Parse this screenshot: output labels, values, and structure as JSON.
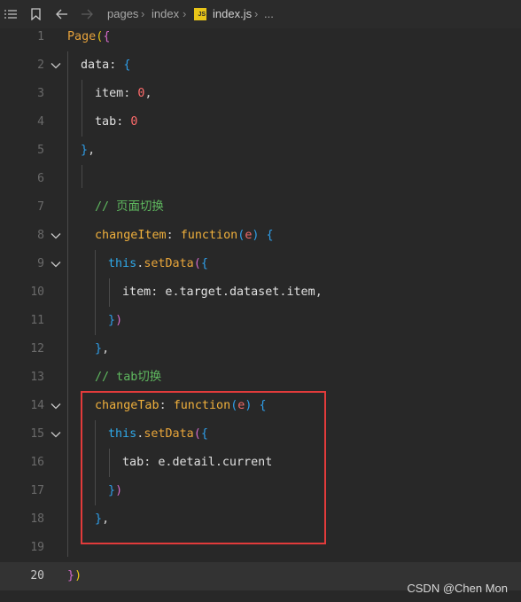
{
  "breadcrumb": {
    "items": [
      "pages",
      "index",
      "index.js",
      "..."
    ],
    "file_badge": "JS"
  },
  "editor": {
    "current_line": 20,
    "lines": [
      {
        "n": "1",
        "tokens": [
          [
            "Page",
            "t-page"
          ],
          [
            "(",
            "t-brace1"
          ],
          [
            "{",
            "t-brace2"
          ]
        ]
      },
      {
        "n": "2",
        "tokens": [
          [
            "data",
            "t-key"
          ],
          [
            ": ",
            "t-punc"
          ],
          [
            "{",
            "t-brace3"
          ]
        ]
      },
      {
        "n": "3",
        "tokens": [
          [
            "item",
            "t-key"
          ],
          [
            ": ",
            "t-punc"
          ],
          [
            "0",
            "t-num"
          ],
          [
            ",",
            "t-punc"
          ]
        ]
      },
      {
        "n": "4",
        "tokens": [
          [
            "tab",
            "t-key"
          ],
          [
            ": ",
            "t-punc"
          ],
          [
            "0",
            "t-num"
          ]
        ]
      },
      {
        "n": "5",
        "tokens": [
          [
            "}",
            "t-brace3"
          ],
          [
            ",",
            "t-punc"
          ]
        ]
      },
      {
        "n": "6",
        "tokens": []
      },
      {
        "n": "7",
        "tokens": [
          [
            "// 页面切换",
            "t-comment"
          ]
        ]
      },
      {
        "n": "8",
        "tokens": [
          [
            "changeItem",
            "t-func"
          ],
          [
            ": ",
            "t-punc"
          ],
          [
            "function",
            "t-keyword"
          ],
          [
            "(",
            "t-brace3"
          ],
          [
            "e",
            "t-param"
          ],
          [
            ") ",
            "t-brace3"
          ],
          [
            "{",
            "t-brace3"
          ]
        ]
      },
      {
        "n": "9",
        "tokens": [
          [
            "this",
            "t-this"
          ],
          [
            ".",
            "t-punc"
          ],
          [
            "setData",
            "t-method"
          ],
          [
            "(",
            "t-brace2"
          ],
          [
            "{",
            "t-brace3"
          ]
        ]
      },
      {
        "n": "10",
        "tokens": [
          [
            "item",
            "t-key"
          ],
          [
            ": ",
            "t-punc"
          ],
          [
            "e",
            "t-ident"
          ],
          [
            ".",
            "t-punc"
          ],
          [
            "target",
            "t-ident"
          ],
          [
            ".",
            "t-punc"
          ],
          [
            "dataset",
            "t-ident"
          ],
          [
            ".",
            "t-punc"
          ],
          [
            "item",
            "t-ident"
          ],
          [
            ",",
            "t-punc"
          ]
        ]
      },
      {
        "n": "11",
        "tokens": [
          [
            "}",
            "t-brace3"
          ],
          [
            ")",
            "t-brace2"
          ]
        ]
      },
      {
        "n": "12",
        "tokens": [
          [
            "}",
            "t-brace3"
          ],
          [
            ",",
            "t-punc"
          ]
        ]
      },
      {
        "n": "13",
        "tokens": [
          [
            "// tab切换",
            "t-comment"
          ]
        ]
      },
      {
        "n": "14",
        "tokens": [
          [
            "changeTab",
            "t-func"
          ],
          [
            ": ",
            "t-punc"
          ],
          [
            "function",
            "t-keyword"
          ],
          [
            "(",
            "t-brace3"
          ],
          [
            "e",
            "t-param"
          ],
          [
            ") ",
            "t-brace3"
          ],
          [
            "{",
            "t-brace3"
          ]
        ]
      },
      {
        "n": "15",
        "tokens": [
          [
            "this",
            "t-this"
          ],
          [
            ".",
            "t-punc"
          ],
          [
            "setData",
            "t-method"
          ],
          [
            "(",
            "t-brace2"
          ],
          [
            "{",
            "t-brace3"
          ]
        ]
      },
      {
        "n": "16",
        "tokens": [
          [
            "tab",
            "t-key"
          ],
          [
            ": ",
            "t-punc"
          ],
          [
            "e",
            "t-ident"
          ],
          [
            ".",
            "t-punc"
          ],
          [
            "detail",
            "t-ident"
          ],
          [
            ".",
            "t-punc"
          ],
          [
            "current",
            "t-ident"
          ]
        ]
      },
      {
        "n": "17",
        "tokens": [
          [
            "}",
            "t-brace3"
          ],
          [
            ")",
            "t-brace2"
          ]
        ]
      },
      {
        "n": "18",
        "tokens": [
          [
            "}",
            "t-brace3"
          ],
          [
            ",",
            "t-punc"
          ]
        ]
      },
      {
        "n": "19",
        "tokens": []
      },
      {
        "n": "20",
        "tokens": [
          [
            "}",
            "t-brace2"
          ],
          [
            ")",
            "t-brace1"
          ]
        ]
      }
    ]
  },
  "watermark": "CSDN @Chen Mon"
}
